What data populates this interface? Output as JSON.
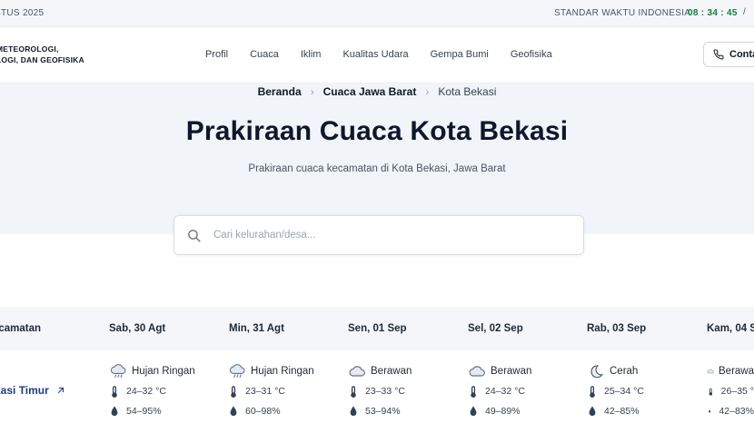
{
  "topbar": {
    "date_text": "STUS 2025",
    "timezone_label": "STANDAR WAKTU INDONESIA",
    "clock": "08 : 34 : 45",
    "separator": "/"
  },
  "header": {
    "brand_line1": "METEOROLOGI,",
    "brand_line2": "LOGI, DAN GEOFISIKA",
    "nav": [
      "Profil",
      "Cuaca",
      "Iklim",
      "Kualitas Udara",
      "Gempa Bumi",
      "Geofisika"
    ],
    "contact_label": "Conta",
    "contact_icon": "phone-icon"
  },
  "hero": {
    "breadcrumb": [
      "Beranda",
      "Cuaca Jawa Barat",
      "Kota Bekasi"
    ],
    "title": "Prakiraan Cuaca Kota Bekasi",
    "subtitle": "Prakiraan cuaca kecamatan di Kota Bekasi, Jawa Barat"
  },
  "search": {
    "placeholder": "Cari kelurahan/desa...",
    "value": ""
  },
  "table": {
    "first_column_header": "ecamatan",
    "days": [
      "Sab, 30 Agt",
      "Min, 31 Agt",
      "Sen, 01 Sep",
      "Sel, 02 Sep",
      "Rab, 03 Sep",
      "Kam, 04 S"
    ],
    "rows": [
      {
        "name": "kasi Timur",
        "cells": [
          {
            "condition": "Hujan Ringan",
            "icon": "cloud-drizzle-icon",
            "temp": "24–32 °C",
            "humidity": "54–95%"
          },
          {
            "condition": "Hujan Ringan",
            "icon": "cloud-drizzle-icon",
            "temp": "23–31 °C",
            "humidity": "60–98%"
          },
          {
            "condition": "Berawan",
            "icon": "cloud-icon",
            "temp": "23–33 °C",
            "humidity": "53–94%"
          },
          {
            "condition": "Berawan",
            "icon": "cloud-icon",
            "temp": "24–32 °C",
            "humidity": "49–89%"
          },
          {
            "condition": "Cerah",
            "icon": "moon-icon",
            "temp": "25–34 °C",
            "humidity": "42–85%"
          },
          {
            "condition": "Berawa",
            "icon": "cloud-icon",
            "temp": "26–35 °",
            "humidity": "42–83%"
          }
        ]
      }
    ]
  },
  "colors": {
    "accent_green": "#15803d",
    "link_blue": "#1e3a8a",
    "hero_bg": "#f1f4f8"
  }
}
